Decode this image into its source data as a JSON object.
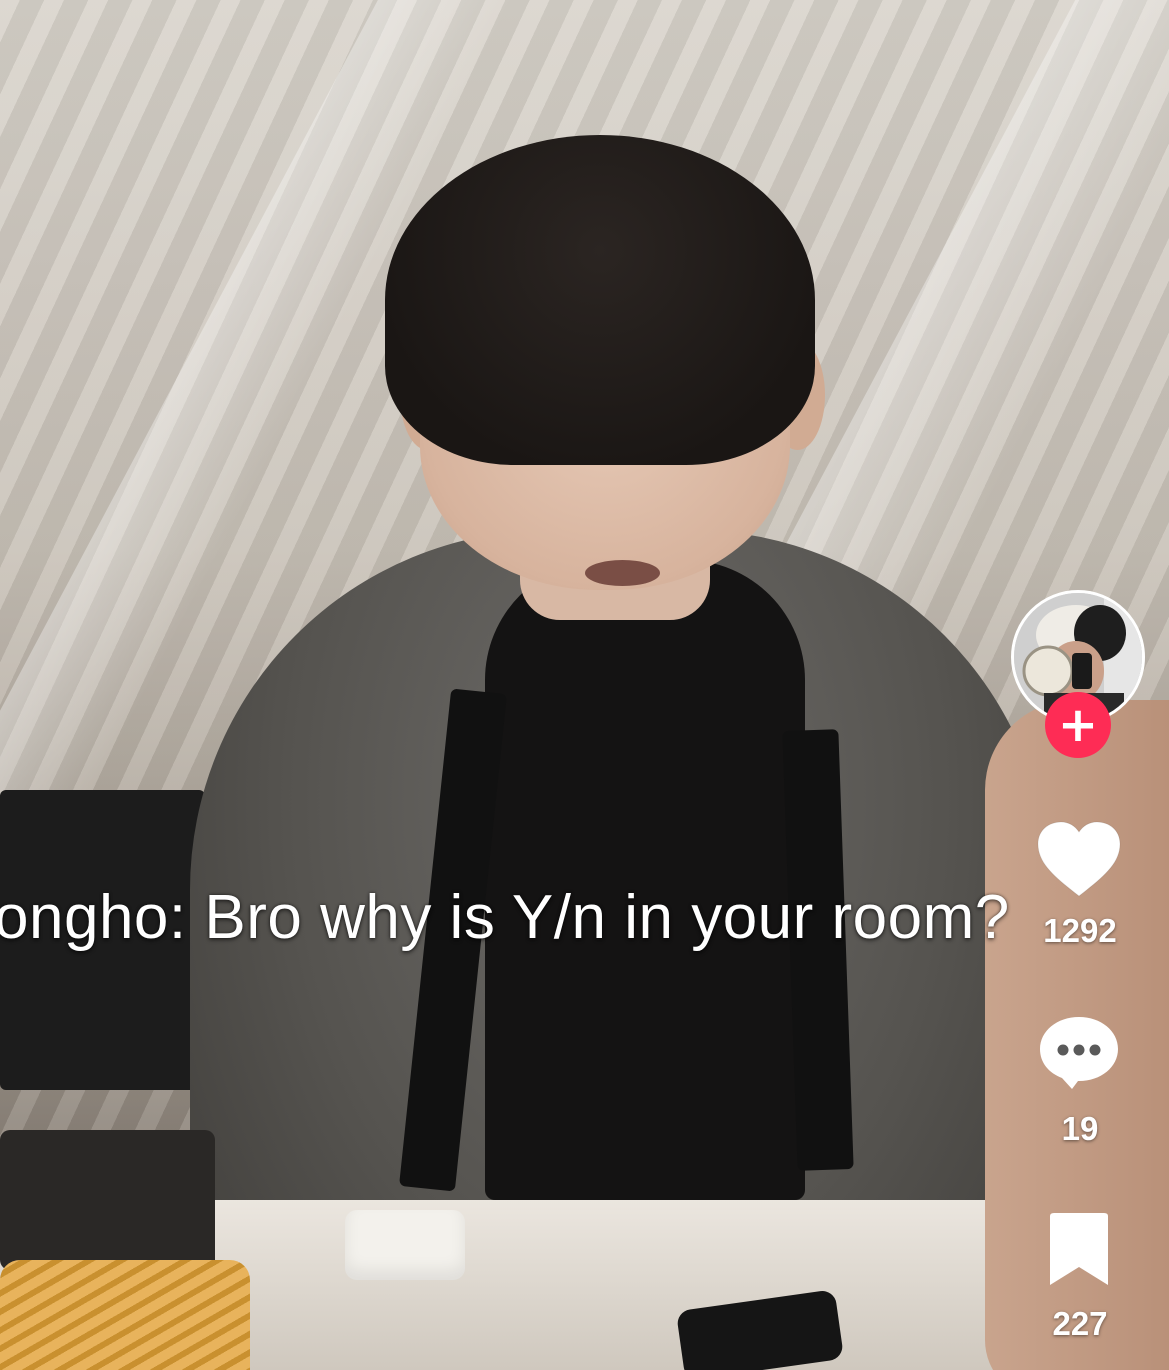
{
  "video": {
    "caption": "ongho: Bro why is Y/n in your room?"
  },
  "creator": {
    "avatar_icon": "profile-avatar",
    "follow_icon": "plus-icon",
    "follow_glyph": "+",
    "follow_color": "#fe2c55"
  },
  "actions": {
    "like": {
      "icon": "heart-icon",
      "count": "1292"
    },
    "comment": {
      "icon": "comment-bubble-icon",
      "count": "19"
    },
    "bookmark": {
      "icon": "bookmark-icon",
      "count": "227"
    }
  }
}
